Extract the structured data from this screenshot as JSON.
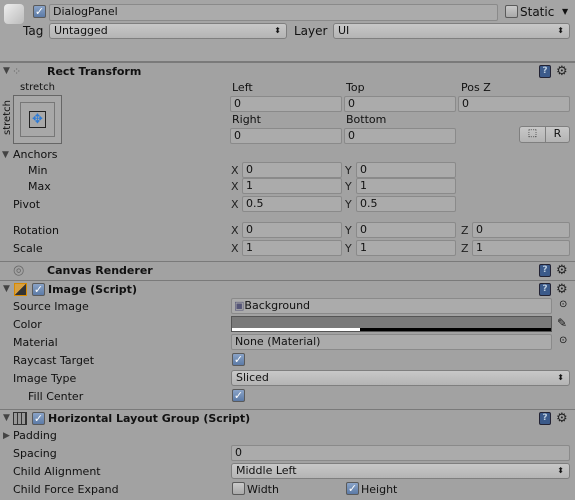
{
  "header": {
    "active": true,
    "name": "DialogPanel",
    "static_label": "Static",
    "static": false,
    "tag_label": "Tag",
    "tag": "Untagged",
    "layer_label": "Layer",
    "layer": "UI"
  },
  "rect_transform": {
    "title": "Rect Transform",
    "anchor_preset_h": "stretch",
    "anchor_preset_v": "stretch",
    "left_label": "Left",
    "left": "0",
    "top_label": "Top",
    "top": "0",
    "posz_label": "Pos Z",
    "posz": "0",
    "right_label": "Right",
    "right": "0",
    "bottom_label": "Bottom",
    "bottom": "0",
    "r_button": "R",
    "anchors_label": "Anchors",
    "min_label": "Min",
    "min": {
      "x": "0",
      "y": "0"
    },
    "max_label": "Max",
    "max": {
      "x": "1",
      "y": "1"
    },
    "pivot_label": "Pivot",
    "pivot": {
      "x": "0.5",
      "y": "0.5"
    },
    "rotation_label": "Rotation",
    "rotation": {
      "x": "0",
      "y": "0",
      "z": "0"
    },
    "scale_label": "Scale",
    "scale": {
      "x": "1",
      "y": "1",
      "z": "1"
    },
    "axis": {
      "x": "X",
      "y": "Y",
      "z": "Z"
    }
  },
  "canvas_renderer": {
    "title": "Canvas Renderer"
  },
  "image": {
    "title": "Image (Script)",
    "enabled": true,
    "source_label": "Source Image",
    "source": "Background",
    "color_label": "Color",
    "color": "#7a7a7a",
    "material_label": "Material",
    "material": "None (Material)",
    "raycast_label": "Raycast Target",
    "raycast": true,
    "type_label": "Image Type",
    "type": "Sliced",
    "fill_label": "Fill Center",
    "fill": true
  },
  "hlg": {
    "title": "Horizontal Layout Group (Script)",
    "enabled": true,
    "padding_label": "Padding",
    "spacing_label": "Spacing",
    "spacing": "0",
    "align_label": "Child Alignment",
    "align": "Middle Left",
    "expand_label": "Child Force Expand",
    "width_label": "Width",
    "width": false,
    "height_label": "Height",
    "height": true
  },
  "icons": {
    "help": "?",
    "gear": "⚙"
  }
}
